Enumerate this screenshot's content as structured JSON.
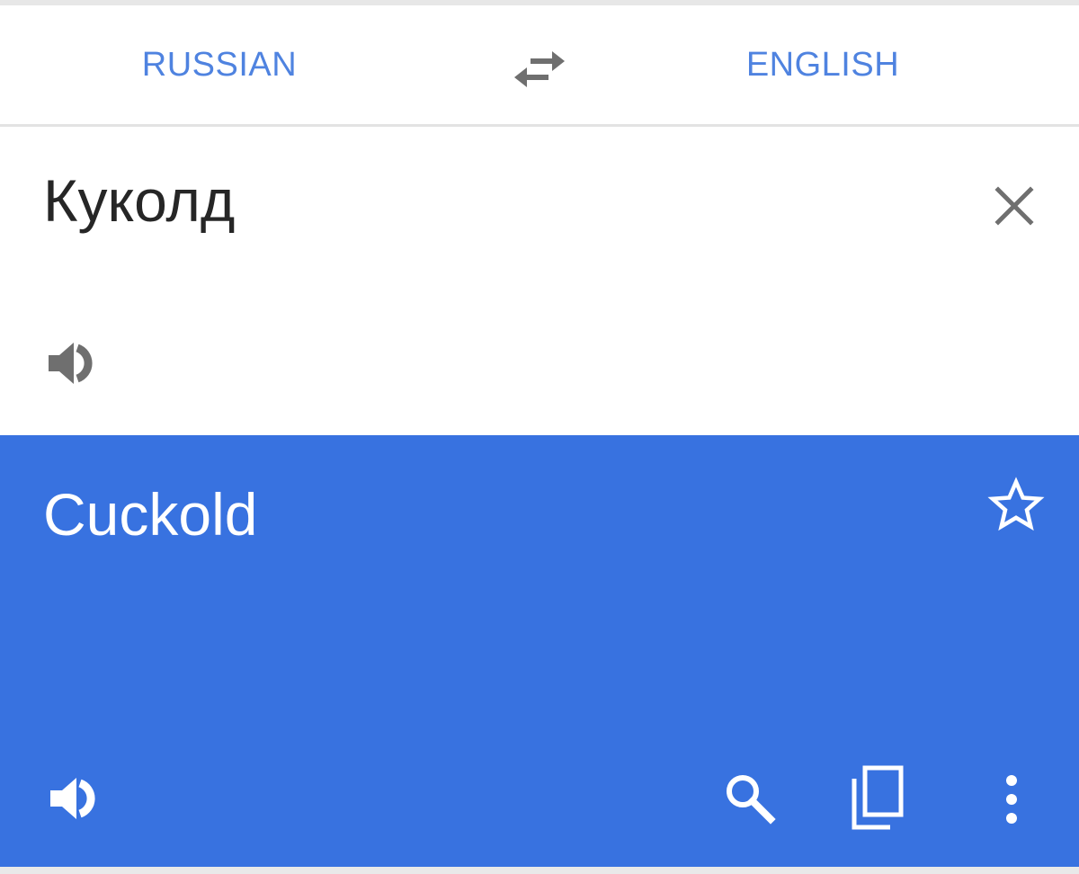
{
  "languages": {
    "source": "RUSSIAN",
    "target": "ENGLISH"
  },
  "input": {
    "text": "Куколд"
  },
  "result": {
    "text": "Cuckold"
  },
  "icons": {
    "swap": "swap-arrows-icon",
    "clear": "close-icon",
    "source_speaker": "speaker-icon",
    "favorite": "star-outline-icon",
    "result_speaker": "speaker-icon",
    "search": "search-icon",
    "copy": "copy-icon",
    "more": "more-vert-icon"
  },
  "colors": {
    "accent": "#4f83e0",
    "result_background": "#3872e0",
    "icon_gray": "#6f6f6f"
  }
}
